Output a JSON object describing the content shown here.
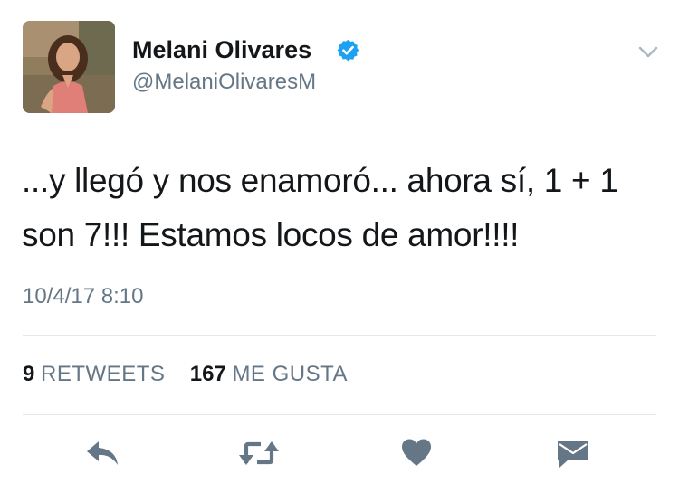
{
  "user": {
    "display_name": "Melani Olivares",
    "handle": "@MelaniOlivaresM",
    "verified": true,
    "avatar_icon": "profile-photo"
  },
  "tweet": {
    "text": "...y llegó y nos enamoró... ahora sí, 1 + 1 son 7!!! Estamos locos de amor!!!!",
    "timestamp": "10/4/17 8:10"
  },
  "stats": {
    "retweets_count": "9",
    "retweets_label": "RETWEETS",
    "likes_count": "167",
    "likes_label": "ME GUSTA"
  },
  "actions": {
    "reply_icon": "reply-icon",
    "retweet_icon": "retweet-icon",
    "like_icon": "heart-icon",
    "dm_icon": "envelope-icon"
  },
  "colors": {
    "text": "#14171a",
    "secondary": "#657786",
    "verified_blue": "#1da1f2",
    "divider": "#e1e8ed",
    "action_icon": "#657786"
  }
}
